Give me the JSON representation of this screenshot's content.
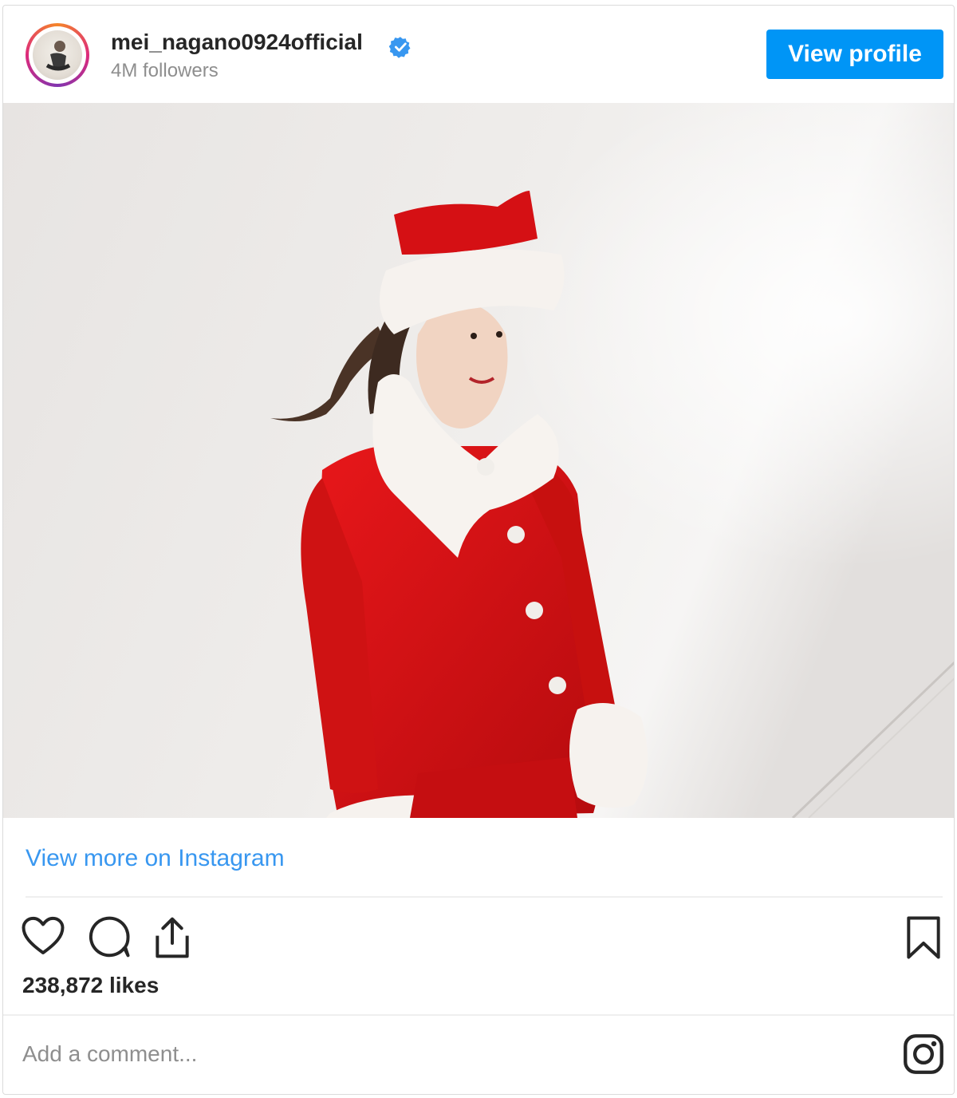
{
  "header": {
    "username": "mei_nagano0924official",
    "followers": "4M followers",
    "view_profile_label": "View profile"
  },
  "post": {
    "view_more_label": "View more on Instagram",
    "likes": "238,872 likes",
    "comment_placeholder": "Add a comment..."
  },
  "icons": {
    "verified": "verified-badge-icon",
    "like": "heart-icon",
    "comment": "comment-icon",
    "share": "share-icon",
    "save": "bookmark-icon",
    "instagram": "instagram-logo-icon"
  },
  "colors": {
    "brand_blue": "#0095f6",
    "link_blue": "#3897f0",
    "text_dark": "#262626",
    "text_muted": "#8e8e8e",
    "costume_red": "#d40f12"
  }
}
